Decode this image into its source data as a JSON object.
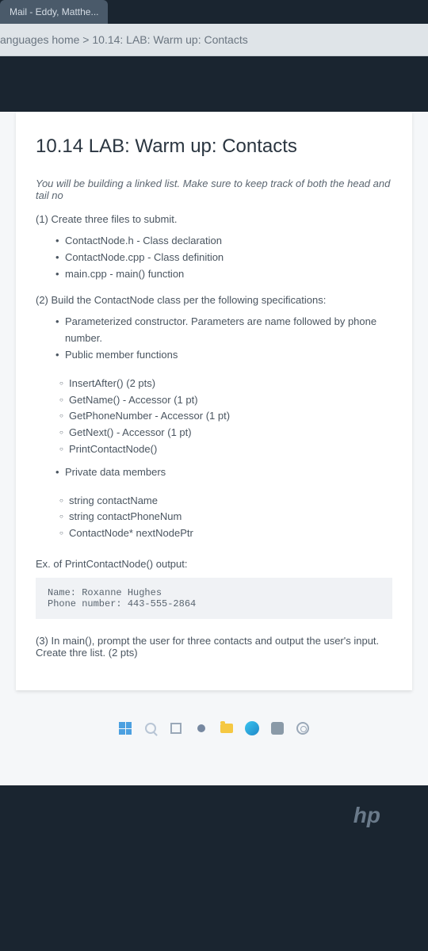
{
  "browser": {
    "tab_title": "Mail - Eddy, Matthe..."
  },
  "breadcrumb": {
    "text": "anguages home > 10.14: LAB: Warm up: Contacts"
  },
  "lab": {
    "title": "10.14 LAB: Warm up: Contacts",
    "intro": "You will be building a linked list. Make sure to keep track of both the head and tail no",
    "step1_label": "(1) Create three files to submit.",
    "step1_items": [
      "ContactNode.h - Class declaration",
      "ContactNode.cpp - Class definition",
      "main.cpp - main() function"
    ],
    "step2_label": "(2) Build the ContactNode class per the following specifications:",
    "step2_items": [
      "Parameterized constructor. Parameters are name followed by phone number.",
      "Public member functions"
    ],
    "step2_sub_a": [
      "InsertAfter() (2 pts)",
      "GetName() - Accessor (1 pt)",
      "GetPhoneNumber - Accessor (1 pt)",
      "GetNext() - Accessor (1 pt)",
      "PrintContactNode()"
    ],
    "step2_private": "Private data members",
    "step2_sub_b": [
      "string contactName",
      "string contactPhoneNum",
      "ContactNode* nextNodePtr"
    ],
    "example_label": "Ex. of PrintContactNode() output:",
    "example_code": "Name: Roxanne Hughes\nPhone number: 443-555-2864",
    "step3_label": "(3) In main(), prompt the user for three contacts and output the user's input. Create thre list. (2 pts)"
  },
  "logo": {
    "text": "hp"
  }
}
